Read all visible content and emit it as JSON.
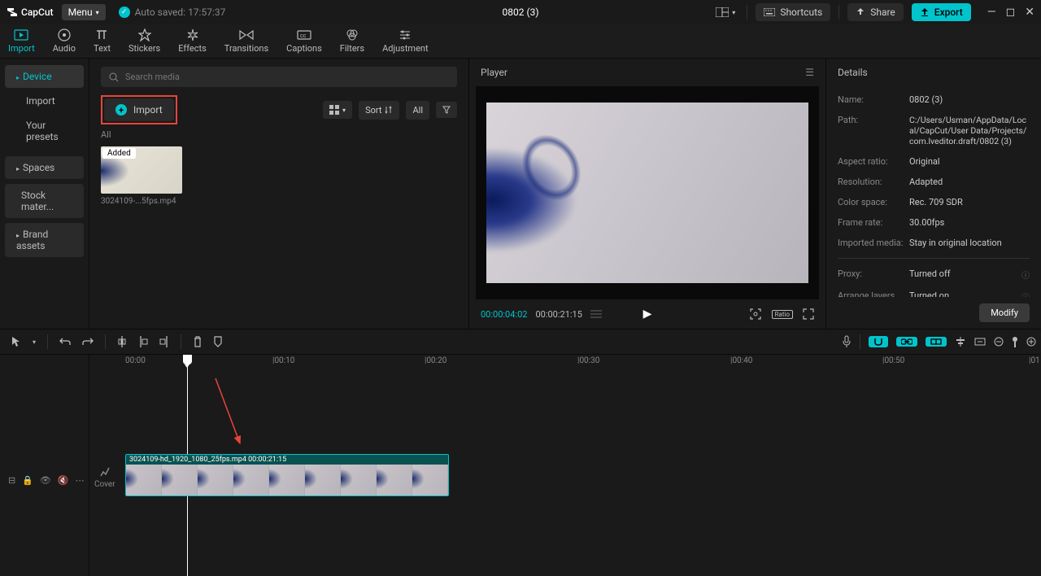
{
  "app": {
    "name": "CapCut",
    "menu_label": "Menu",
    "autosave": "Auto saved: 17:57:37",
    "project_title": "0802 (3)"
  },
  "titlebar": {
    "shortcuts": "Shortcuts",
    "share": "Share",
    "export": "Export"
  },
  "ribbon": {
    "tabs": [
      {
        "label": "Import"
      },
      {
        "label": "Audio"
      },
      {
        "label": "Text"
      },
      {
        "label": "Stickers"
      },
      {
        "label": "Effects"
      },
      {
        "label": "Transitions"
      },
      {
        "label": "Captions"
      },
      {
        "label": "Filters"
      },
      {
        "label": "Adjustment"
      }
    ]
  },
  "sidebar": {
    "items": [
      {
        "label": "Device",
        "active": true,
        "collapsible": true
      },
      {
        "label": "Import"
      },
      {
        "label": "Your presets"
      },
      {
        "label": "Spaces",
        "collapsible": true
      },
      {
        "label": "Stock mater..."
      },
      {
        "label": "Brand assets",
        "collapsible": true
      }
    ]
  },
  "media": {
    "search_placeholder": "Search media",
    "import_label": "Import",
    "sort_label": "Sort",
    "filter_all": "All",
    "section_all": "All",
    "items": [
      {
        "name": "3024109-...5fps.mp4",
        "badge": "Added"
      }
    ]
  },
  "player": {
    "title": "Player",
    "time_current": "00:00:04:02",
    "time_total": "00:00:21:15",
    "ratio_label": "Ratio"
  },
  "details": {
    "title": "Details",
    "rows": [
      {
        "label": "Name:",
        "value": "0802 (3)"
      },
      {
        "label": "Path:",
        "value": "C:/Users/Usman/AppData/Local/CapCut/User Data/Projects/com.lveditor.draft/0802 (3)"
      },
      {
        "label": "Aspect ratio:",
        "value": "Original"
      },
      {
        "label": "Resolution:",
        "value": "Adapted"
      },
      {
        "label": "Color space:",
        "value": "Rec. 709 SDR"
      },
      {
        "label": "Frame rate:",
        "value": "30.00fps"
      },
      {
        "label": "Imported media:",
        "value": "Stay in original location"
      }
    ],
    "rows2": [
      {
        "label": "Proxy:",
        "value": "Turned off"
      },
      {
        "label": "Arrange layers",
        "value": "Turned on"
      }
    ],
    "modify": "Modify"
  },
  "timeline": {
    "ruler": [
      "00:00",
      "|00:10",
      "|00:20",
      "|00:30",
      "|00:40",
      "|00:50",
      "|01"
    ],
    "clip_label": "3024109-hd_1920_1080_25fps.mp4  00:00:21:15",
    "cover": "Cover"
  }
}
